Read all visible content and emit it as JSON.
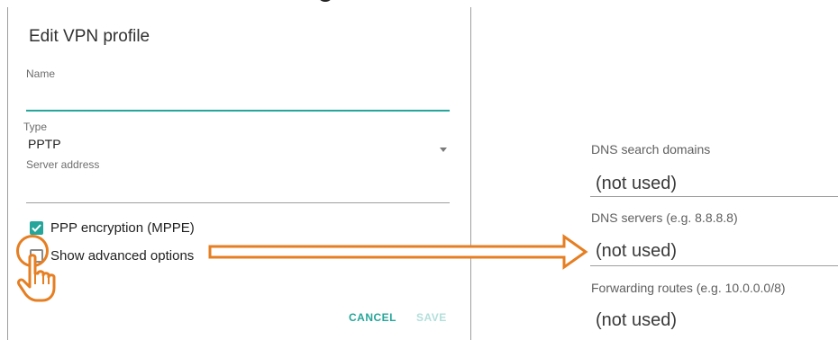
{
  "dialog": {
    "title": "Edit VPN profile",
    "name_label": "Name",
    "name_value": "",
    "type_label": "Type",
    "type_value": "PPTP",
    "server_label": "Server address",
    "server_value": "",
    "ppp_encryption": {
      "label": "PPP encryption (MPPE)",
      "checked": true
    },
    "show_advanced": {
      "label": "Show advanced options",
      "checked": false
    },
    "cancel_label": "CANCEL",
    "save_label": "SAVE"
  },
  "advanced": {
    "dns_search_label": "DNS search domains",
    "dns_search_value": "(not used)",
    "dns_servers_label": "DNS servers (e.g. 8.8.8.8)",
    "dns_servers_value": "(not used)",
    "forwarding_label": "Forwarding routes (e.g. 10.0.0.0/8)",
    "forwarding_value": "(not used)"
  },
  "colors": {
    "accent": "#26a69a",
    "annotation": "#e67e22"
  },
  "icons": [
    "checkbox-checked-icon",
    "checkbox-unchecked-icon",
    "dropdown-caret-icon",
    "pointing-hand-icon",
    "arrow-right-icon"
  ]
}
